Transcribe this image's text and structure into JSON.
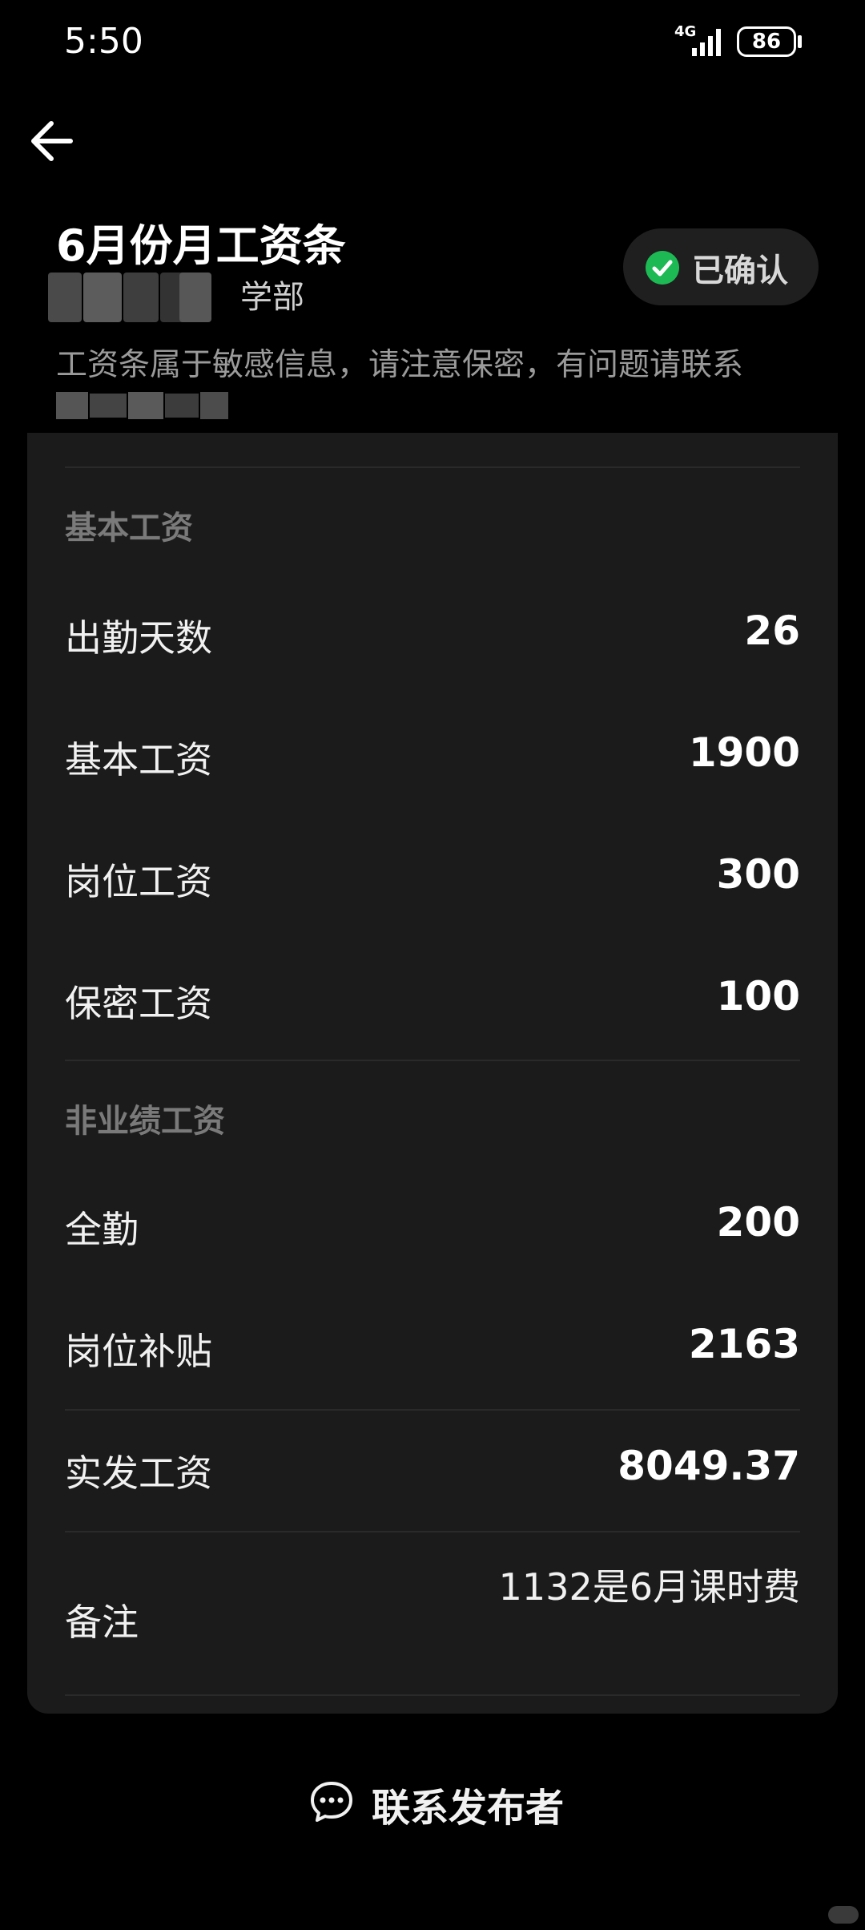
{
  "status_bar": {
    "time": "5:50",
    "network": "4G",
    "battery": "86"
  },
  "header": {
    "title": "6月份月工资条",
    "department_suffix": "学部",
    "status_label": "已确认",
    "status_color": "#1db954",
    "notice": "工资条属于敏感信息，请注意保密，有问题请联系"
  },
  "sections": [
    {
      "title": "基本工资",
      "rows": [
        {
          "label": "出勤天数",
          "value": "26"
        },
        {
          "label": "基本工资",
          "value": "1900"
        },
        {
          "label": "岗位工资",
          "value": "300"
        },
        {
          "label": "保密工资",
          "value": "100"
        }
      ]
    },
    {
      "title": "非业绩工资",
      "rows": [
        {
          "label": "全勤",
          "value": "200"
        },
        {
          "label": "岗位补贴",
          "value": "2163"
        }
      ]
    }
  ],
  "net_pay": {
    "label": "实发工资",
    "value": "8049.37"
  },
  "remark": {
    "label": "备注",
    "value": "1132是6月课时费"
  },
  "footer": {
    "contact_label": "联系发布者"
  }
}
